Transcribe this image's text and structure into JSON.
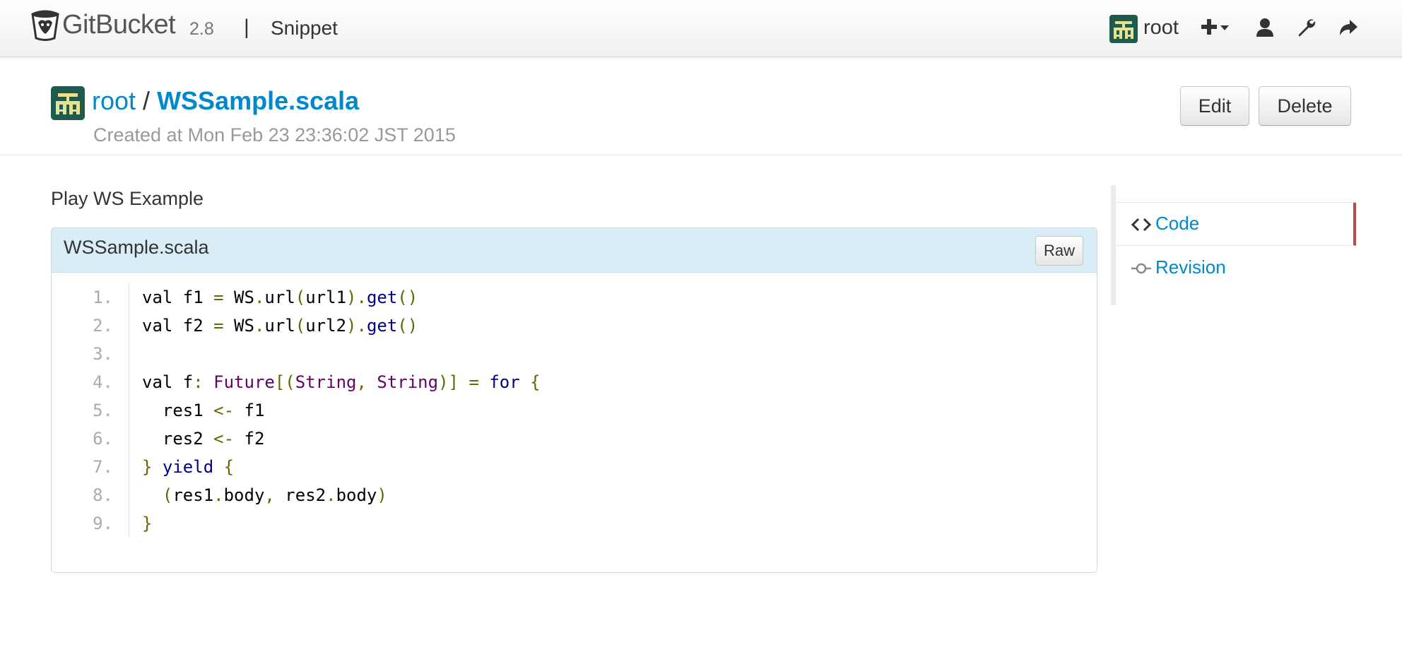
{
  "navbar": {
    "brand_name": "GitBucket",
    "version": "2.8",
    "separator": "|",
    "section": "Snippet",
    "user": "root",
    "icons": [
      "plus-dropdown-icon",
      "user-icon",
      "wrench-icon",
      "sign-out-icon"
    ]
  },
  "snippet": {
    "owner": "root",
    "slash": "/",
    "filename": "WSSample.scala",
    "created_at": "Created at Mon Feb 23 23:36:02 JST 2015",
    "edit_label": "Edit",
    "delete_label": "Delete",
    "description": "Play WS Example"
  },
  "file": {
    "name": "WSSample.scala",
    "raw_label": "Raw",
    "line_numbers": [
      "1.",
      "2.",
      "3.",
      "4.",
      "5.",
      "6.",
      "7.",
      "8.",
      "9."
    ],
    "lines": [
      [
        [
          "pln",
          "val f1 "
        ],
        [
          "pun",
          "="
        ],
        [
          "pln",
          " WS"
        ],
        [
          "pun",
          "."
        ],
        [
          "pln",
          "url"
        ],
        [
          "pun",
          "("
        ],
        [
          "pln",
          "url1"
        ],
        [
          "pun",
          ")."
        ],
        [
          "kwd",
          "get"
        ],
        [
          "pun",
          "()"
        ]
      ],
      [
        [
          "pln",
          "val f2 "
        ],
        [
          "pun",
          "="
        ],
        [
          "pln",
          " WS"
        ],
        [
          "pun",
          "."
        ],
        [
          "pln",
          "url"
        ],
        [
          "pun",
          "("
        ],
        [
          "pln",
          "url2"
        ],
        [
          "pun",
          ")."
        ],
        [
          "kwd",
          "get"
        ],
        [
          "pun",
          "()"
        ]
      ],
      [],
      [
        [
          "pln",
          "val f"
        ],
        [
          "pun",
          ":"
        ],
        [
          "pln",
          " "
        ],
        [
          "typ",
          "Future"
        ],
        [
          "pun",
          "[("
        ],
        [
          "typ",
          "String"
        ],
        [
          "pun",
          ","
        ],
        [
          "pln",
          " "
        ],
        [
          "typ",
          "String"
        ],
        [
          "pun",
          ")]"
        ],
        [
          "pln",
          " "
        ],
        [
          "pun",
          "="
        ],
        [
          "pln",
          " "
        ],
        [
          "kwd",
          "for"
        ],
        [
          "pln",
          " "
        ],
        [
          "pun",
          "{"
        ]
      ],
      [
        [
          "pln",
          "  res1 "
        ],
        [
          "pun",
          "<-"
        ],
        [
          "pln",
          " f1"
        ]
      ],
      [
        [
          "pln",
          "  res2 "
        ],
        [
          "pun",
          "<-"
        ],
        [
          "pln",
          " f2"
        ]
      ],
      [
        [
          "pun",
          "}"
        ],
        [
          "pln",
          " "
        ],
        [
          "kwd",
          "yield"
        ],
        [
          "pln",
          " "
        ],
        [
          "pun",
          "{"
        ]
      ],
      [
        [
          "pln",
          "  "
        ],
        [
          "pun",
          "("
        ],
        [
          "pln",
          "res1"
        ],
        [
          "pun",
          "."
        ],
        [
          "pln",
          "body"
        ],
        [
          "pun",
          ","
        ],
        [
          "pln",
          " res2"
        ],
        [
          "pun",
          "."
        ],
        [
          "pln",
          "body"
        ],
        [
          "pun",
          ")"
        ]
      ],
      [
        [
          "pun",
          "}"
        ]
      ]
    ]
  },
  "side_menu": {
    "items": [
      {
        "label": "Code",
        "icon": "code-icon",
        "active": true
      },
      {
        "label": "Revision",
        "icon": "git-commit-icon",
        "active": false
      }
    ]
  },
  "colors": {
    "link": "#0088cc",
    "file_header_bg": "#d9edf7",
    "active_marker": "#b94a48",
    "avatar_bg": "#1e5a4e",
    "avatar_fg": "#e8e290"
  }
}
